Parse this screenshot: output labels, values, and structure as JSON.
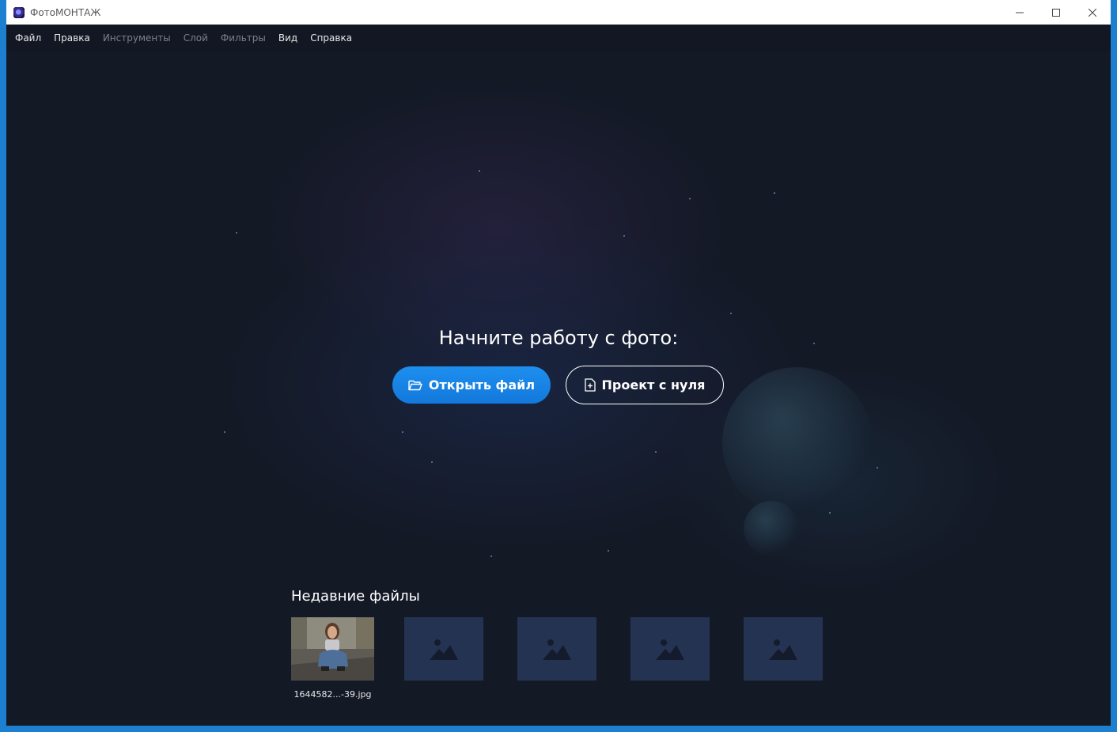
{
  "window": {
    "title": "ФотоМОНТАЖ",
    "controls": {
      "minimize": "—",
      "maximize": "☐",
      "close": "✕"
    }
  },
  "menu": [
    {
      "label": "Файл",
      "enabled": true
    },
    {
      "label": "Правка",
      "enabled": true
    },
    {
      "label": "Инструменты",
      "enabled": false
    },
    {
      "label": "Слой",
      "enabled": false
    },
    {
      "label": "Фильтры",
      "enabled": false
    },
    {
      "label": "Вид",
      "enabled": true
    },
    {
      "label": "Справка",
      "enabled": true
    }
  ],
  "start": {
    "headline": "Начните работу с фото:",
    "open_button": "Открыть файл",
    "new_button": "Проект с нуля"
  },
  "recent": {
    "title": "Недавние файлы",
    "files": [
      {
        "name": "1644582...-39.jpg",
        "has_thumbnail": true
      }
    ],
    "placeholders": [
      {
        "icon": "image-placeholder-icon"
      },
      {
        "icon": "image-placeholder-icon"
      },
      {
        "icon": "image-placeholder-icon"
      },
      {
        "icon": "image-placeholder-icon"
      }
    ]
  },
  "colors": {
    "background": "#141926",
    "primary_button": "#1683e6",
    "placeholder_tile": "#253352"
  }
}
